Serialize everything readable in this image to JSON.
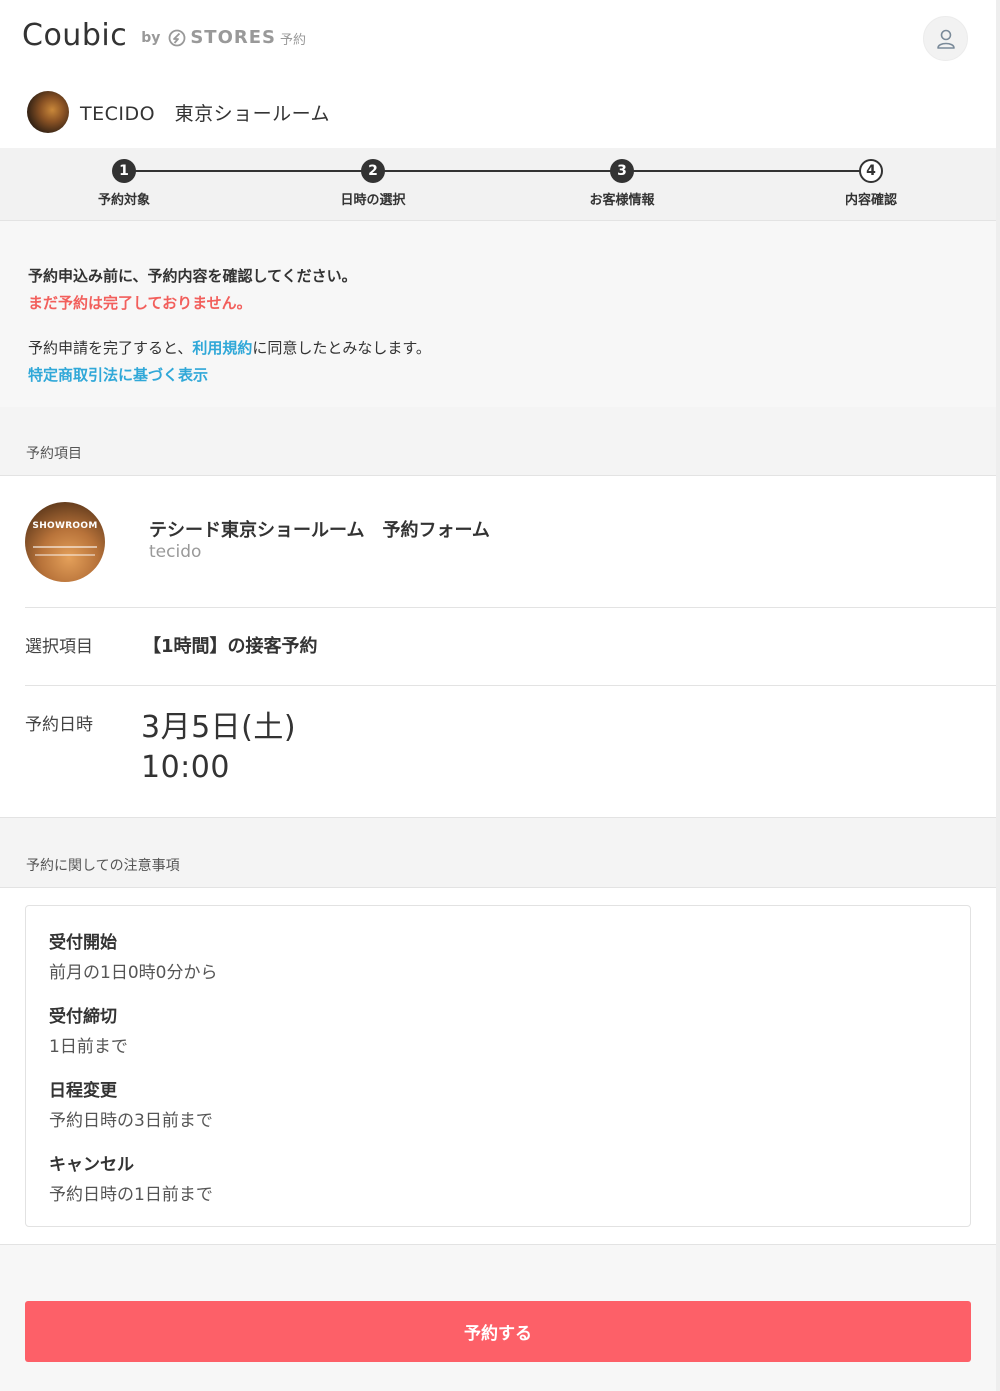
{
  "header": {
    "logo": "Coubic",
    "by": "by",
    "stores": "STORES",
    "stores_sub": "予約",
    "shop_name": "TECIDO　東京ショールーム"
  },
  "steps": [
    {
      "num": "1",
      "label": "予約対象"
    },
    {
      "num": "2",
      "label": "日時の選択"
    },
    {
      "num": "3",
      "label": "お客様情報"
    },
    {
      "num": "4",
      "label": "内容確認"
    }
  ],
  "notice": {
    "line1": "予約申込み前に、予約内容を確認してください。",
    "line2": "まだ予約は完了しておりません。",
    "terms_prefix": "予約申請を完了すると、",
    "terms_link": "利用規約",
    "terms_suffix": "に同意したとみなします。",
    "commerce_link": "特定商取引法に基づく表示"
  },
  "reservation": {
    "section_title": "予約項目",
    "item_title": "テシード東京ショールーム　予約フォーム",
    "item_sub": "tecido",
    "thumb_text": "SHOWROOM",
    "selected_label": "選択項目",
    "selected_value": "【1時間】の接客予約",
    "datetime_label": "予約日時",
    "date": "3月5日(土)",
    "time": "10:00"
  },
  "rules": {
    "section_title": "予約に関しての注意事項",
    "items": [
      {
        "heading": "受付開始",
        "value": "前月の1日0時0分から"
      },
      {
        "heading": "受付締切",
        "value": "1日前まで"
      },
      {
        "heading": "日程変更",
        "value": "予約日時の3日前まで"
      },
      {
        "heading": "キャンセル",
        "value": "予約日時の1日前まで"
      }
    ]
  },
  "submit_label": "予約する",
  "colors": {
    "accent": "#fd6068",
    "warning": "#f25f5c",
    "link": "#30a8d8"
  }
}
